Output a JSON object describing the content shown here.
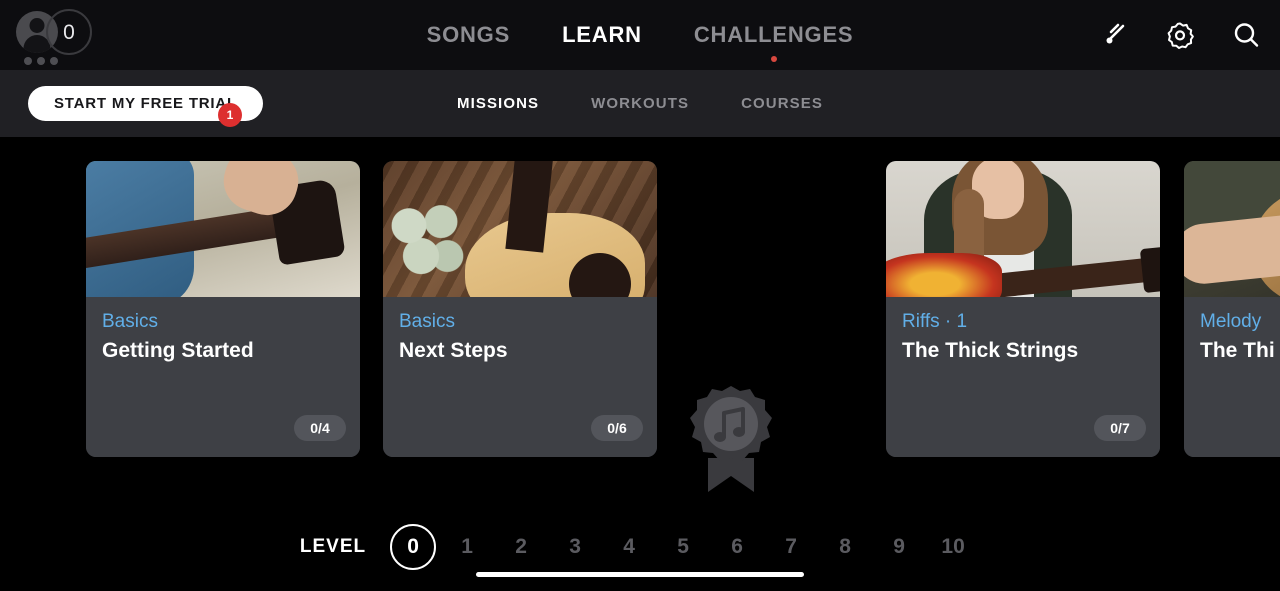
{
  "top_nav": {
    "avatar": {
      "icon": "avatar-person-icon",
      "streak_count": "0",
      "dots": 3
    },
    "items": [
      {
        "label": "SONGS",
        "active": false,
        "dot": false
      },
      {
        "label": "LEARN",
        "active": true,
        "dot": false
      },
      {
        "label": "CHALLENGES",
        "active": false,
        "dot": true
      }
    ],
    "icons": [
      {
        "name": "tuner-fork-icon",
        "label": "Tuner"
      },
      {
        "name": "gear-icon",
        "label": "Settings"
      },
      {
        "name": "search-icon",
        "label": "Search"
      }
    ]
  },
  "sub_nav": {
    "trial_button": {
      "label": "START MY FREE TRIAL",
      "badge": "1"
    },
    "tabs": [
      {
        "label": "MISSIONS",
        "active": true
      },
      {
        "label": "WORKOUTS",
        "active": false
      },
      {
        "label": "COURSES",
        "active": false
      }
    ]
  },
  "cards": [
    {
      "category": "Basics",
      "title": "Getting Started",
      "progress": "0/4",
      "image": "man-holding-electric-guitar-headstock"
    },
    {
      "category": "Basics",
      "title": "Next Steps",
      "progress": "0/6",
      "image": "acoustic-guitar-on-wood-with-eucalyptus"
    },
    {
      "category": "Riffs · 1",
      "title": "The Thick Strings",
      "progress": "0/7",
      "image": "woman-playing-sunburst-les-paul"
    },
    {
      "category": "Melody",
      "title": "The Thi",
      "progress": "",
      "image": "person-playing-acoustic-guitar-closeup"
    }
  ],
  "medal": {
    "name": "music-note-award-medal",
    "locked": true
  },
  "level_selector": {
    "label": "LEVEL",
    "levels": [
      "0",
      "1",
      "2",
      "3",
      "4",
      "5",
      "6",
      "7",
      "8",
      "9",
      "10"
    ],
    "active_index": 0
  },
  "colors": {
    "background": "#000000",
    "top_nav_bg": "#0d0d10",
    "sub_nav_bg": "#202024",
    "card_bg": "#3e4045",
    "category_blue": "#61afe8",
    "badge_red": "#dd2f2f",
    "accent_white": "#ffffff",
    "muted_text": "#8d8d92"
  }
}
